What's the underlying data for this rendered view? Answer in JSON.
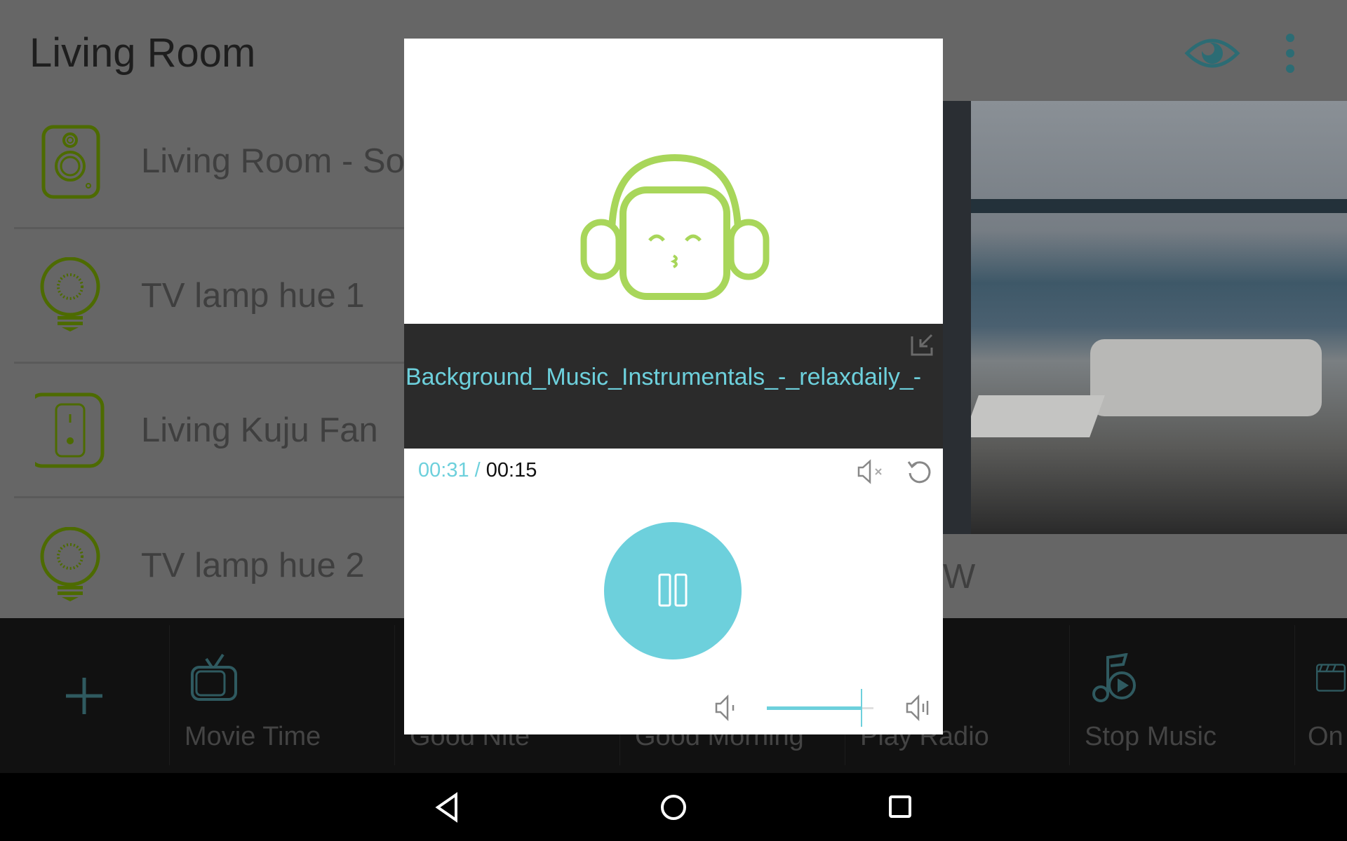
{
  "header": {
    "title": "Living Room",
    "eye_icon": "eye-icon",
    "menu_icon": "more-vertical-icon"
  },
  "devices": [
    {
      "label": "Living Room - So",
      "icon": "speaker-icon"
    },
    {
      "label": "TV lamp hue 1",
      "icon": "bulb-icon"
    },
    {
      "label": "Living Kuju Fan",
      "icon": "switch-icon"
    },
    {
      "label": "TV lamp hue 2",
      "icon": "bulb-icon"
    }
  ],
  "side_panel": {
    "partial_text": "W"
  },
  "scenes": {
    "add_icon": "plus-icon",
    "items": [
      {
        "label": "Movie Time",
        "icon": "tv-icon"
      },
      {
        "label": "Good Nite",
        "icon": "moon-icon"
      },
      {
        "label": "Good Morning",
        "icon": "sun-icon"
      },
      {
        "label": "Play Radio",
        "icon": "radio-icon"
      },
      {
        "label": "Stop Music",
        "icon": "music-icon"
      },
      {
        "label": "On",
        "icon": "clapper-icon"
      }
    ]
  },
  "player": {
    "filename": "Background_Music_Instrumentals_-_relaxdaily_-",
    "current_time": "00:31",
    "separator": " / ",
    "total_time": "00:15",
    "volume": 0.89,
    "state": "playing",
    "accent": "#6dd0dc",
    "logo_color": "#a8d65a"
  },
  "navbar": {
    "icons": [
      "back-icon",
      "home-icon",
      "recents-icon"
    ]
  }
}
